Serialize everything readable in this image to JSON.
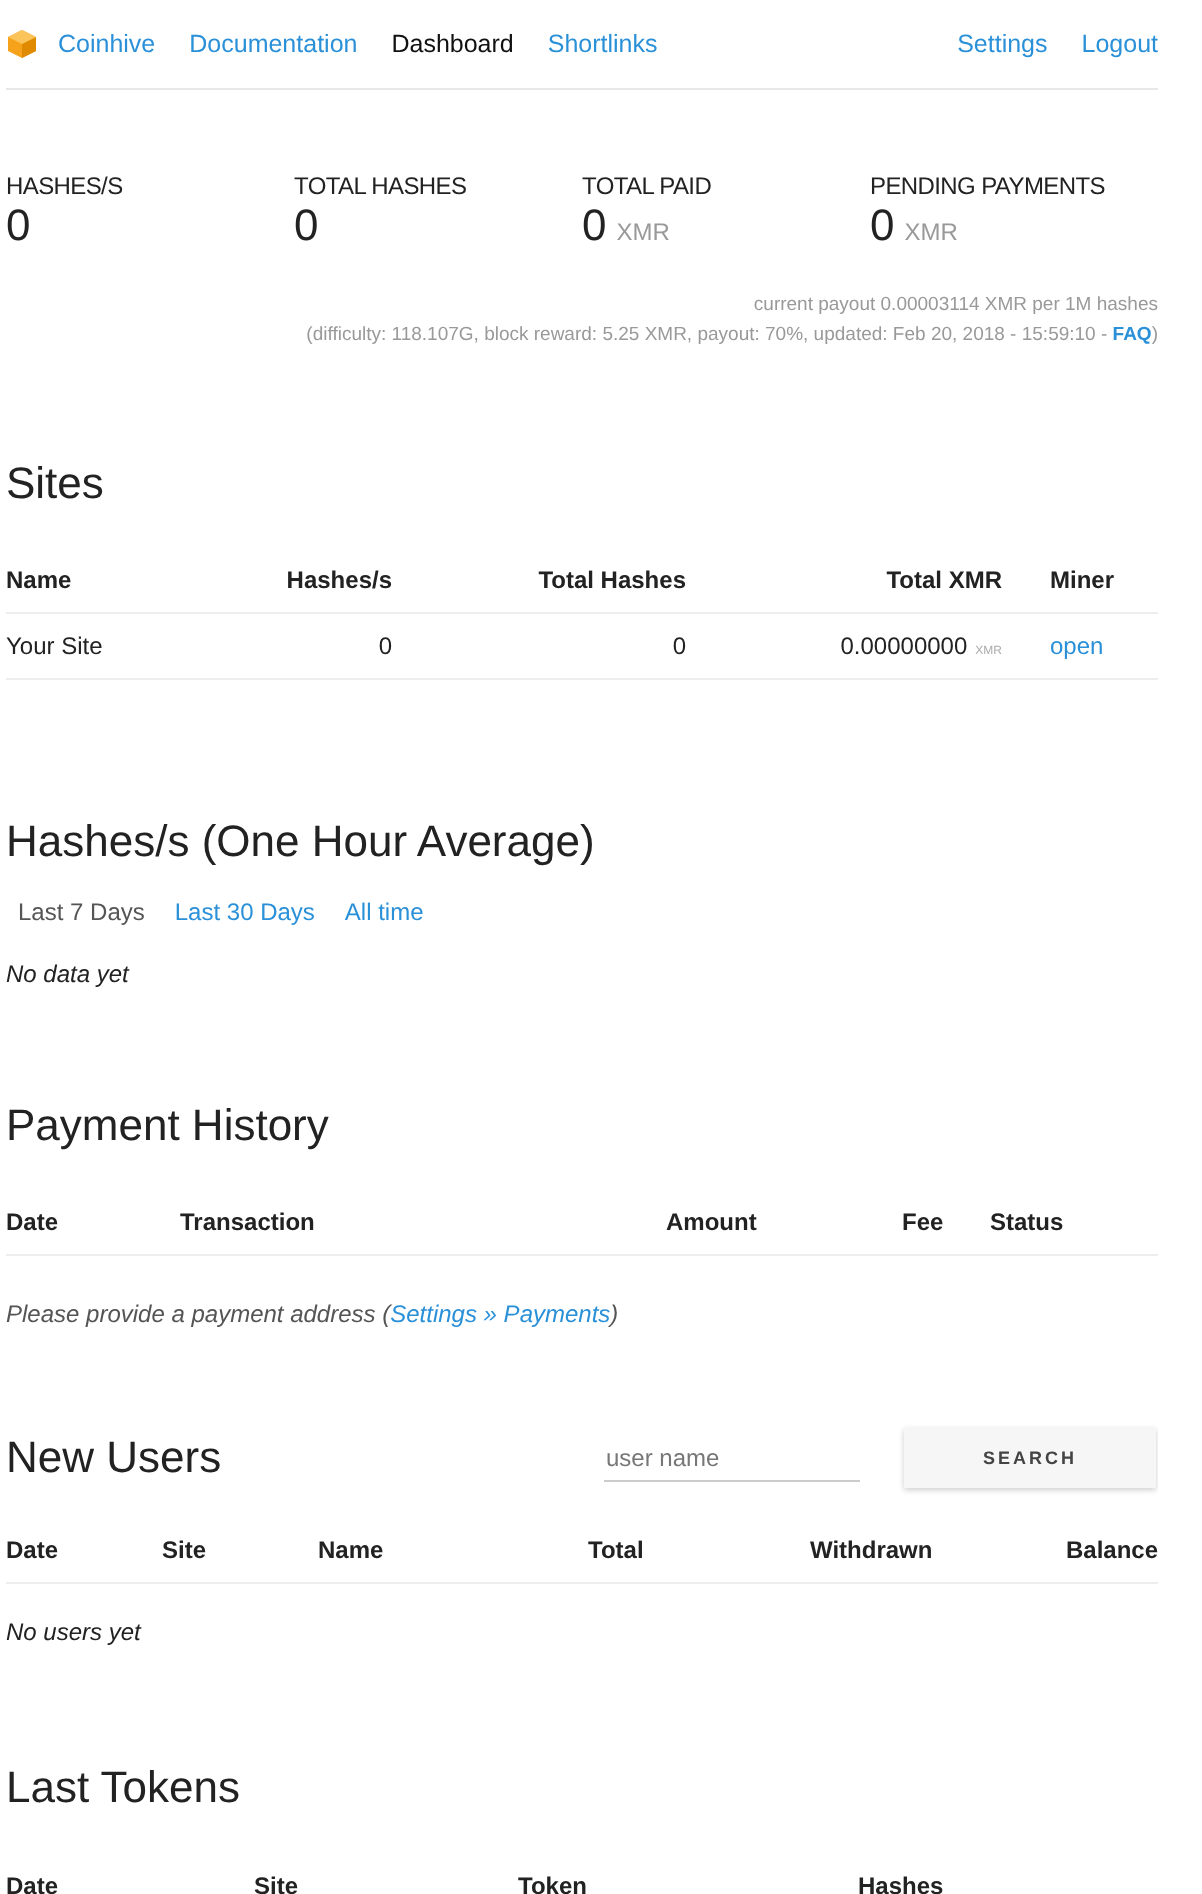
{
  "nav": {
    "brand": "Coinhive",
    "items": [
      {
        "label": "Documentation",
        "selected": false
      },
      {
        "label": "Dashboard",
        "selected": true
      },
      {
        "label": "Shortlinks",
        "selected": false
      }
    ],
    "right": [
      {
        "label": "Settings"
      },
      {
        "label": "Logout"
      }
    ]
  },
  "stats": [
    {
      "label": "HASHES/S",
      "value": "0"
    },
    {
      "label": "TOTAL HASHES",
      "value": "0"
    },
    {
      "label": "TOTAL PAID",
      "value": "0",
      "unit": "XMR"
    },
    {
      "label": "PENDING PAYMENTS",
      "value": "0",
      "unit": "XMR"
    }
  ],
  "payout": {
    "line": "current payout 0.00003114 XMR per 1M hashes",
    "details": "(difficulty: 118.107G, block reward: 5.25 XMR, payout: 70%, updated: Feb 20, 2018 - 15:59:10 - ",
    "faq": "FAQ",
    "close": ")"
  },
  "sites": {
    "title": "Sites",
    "columns": [
      "Name",
      "Hashes/s",
      "Total Hashes",
      "Total XMR",
      "Miner"
    ],
    "rows": [
      {
        "name": "Your Site",
        "hashes_per_s": "0",
        "total_hashes": "0",
        "total_xmr": "0.00000000",
        "unit": "XMR",
        "miner": "open"
      }
    ]
  },
  "hashrate": {
    "title": "Hashes/s (One Hour Average)",
    "tabs": [
      {
        "label": "Last 7 Days",
        "selected": true
      },
      {
        "label": "Last 30 Days",
        "selected": false
      },
      {
        "label": "All time",
        "selected": false
      }
    ],
    "empty": "No data yet"
  },
  "payments": {
    "title": "Payment History",
    "columns": [
      "Date",
      "Transaction",
      "Amount",
      "Fee",
      "Status"
    ],
    "note": "Please provide a payment address (",
    "link": "Settings » Payments",
    "close": ")"
  },
  "users": {
    "title": "New Users",
    "search": {
      "placeholder": "user name"
    },
    "button": "SEARCH",
    "columns": [
      "Date",
      "Site",
      "Name",
      "Total",
      "Withdrawn",
      "Balance"
    ],
    "empty": "No users yet"
  },
  "tokens": {
    "title": "Last Tokens",
    "columns": [
      "Date",
      "Site",
      "Token",
      "Hashes"
    ]
  }
}
